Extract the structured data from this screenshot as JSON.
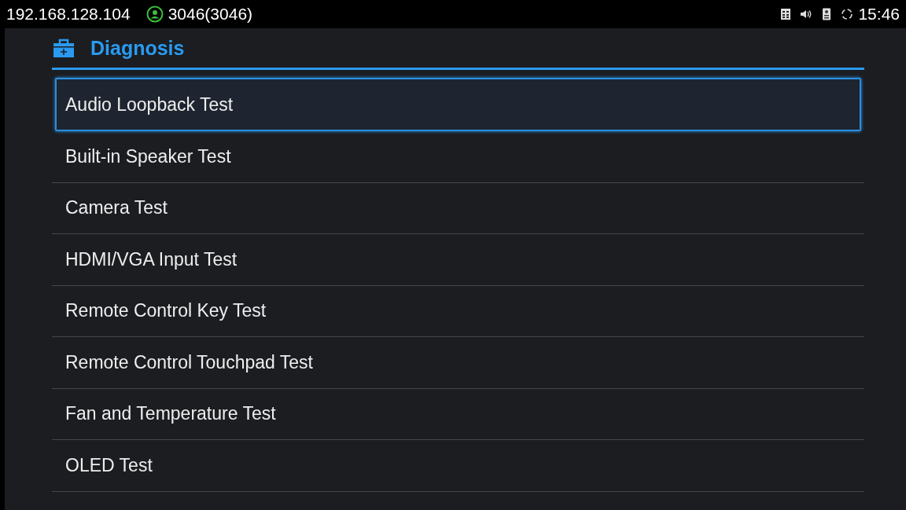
{
  "status_bar": {
    "ip": "192.168.128.104",
    "account": "3046(3046)",
    "time": "15:46"
  },
  "header": {
    "title": "Diagnosis"
  },
  "items": [
    {
      "label": "Audio Loopback Test",
      "selected": true
    },
    {
      "label": "Built-in Speaker Test",
      "selected": false
    },
    {
      "label": "Camera Test",
      "selected": false
    },
    {
      "label": "HDMI/VGA Input Test",
      "selected": false
    },
    {
      "label": "Remote Control Key Test",
      "selected": false
    },
    {
      "label": "Remote Control Touchpad Test",
      "selected": false
    },
    {
      "label": "Fan and Temperature Test",
      "selected": false
    },
    {
      "label": "OLED Test",
      "selected": false
    }
  ]
}
